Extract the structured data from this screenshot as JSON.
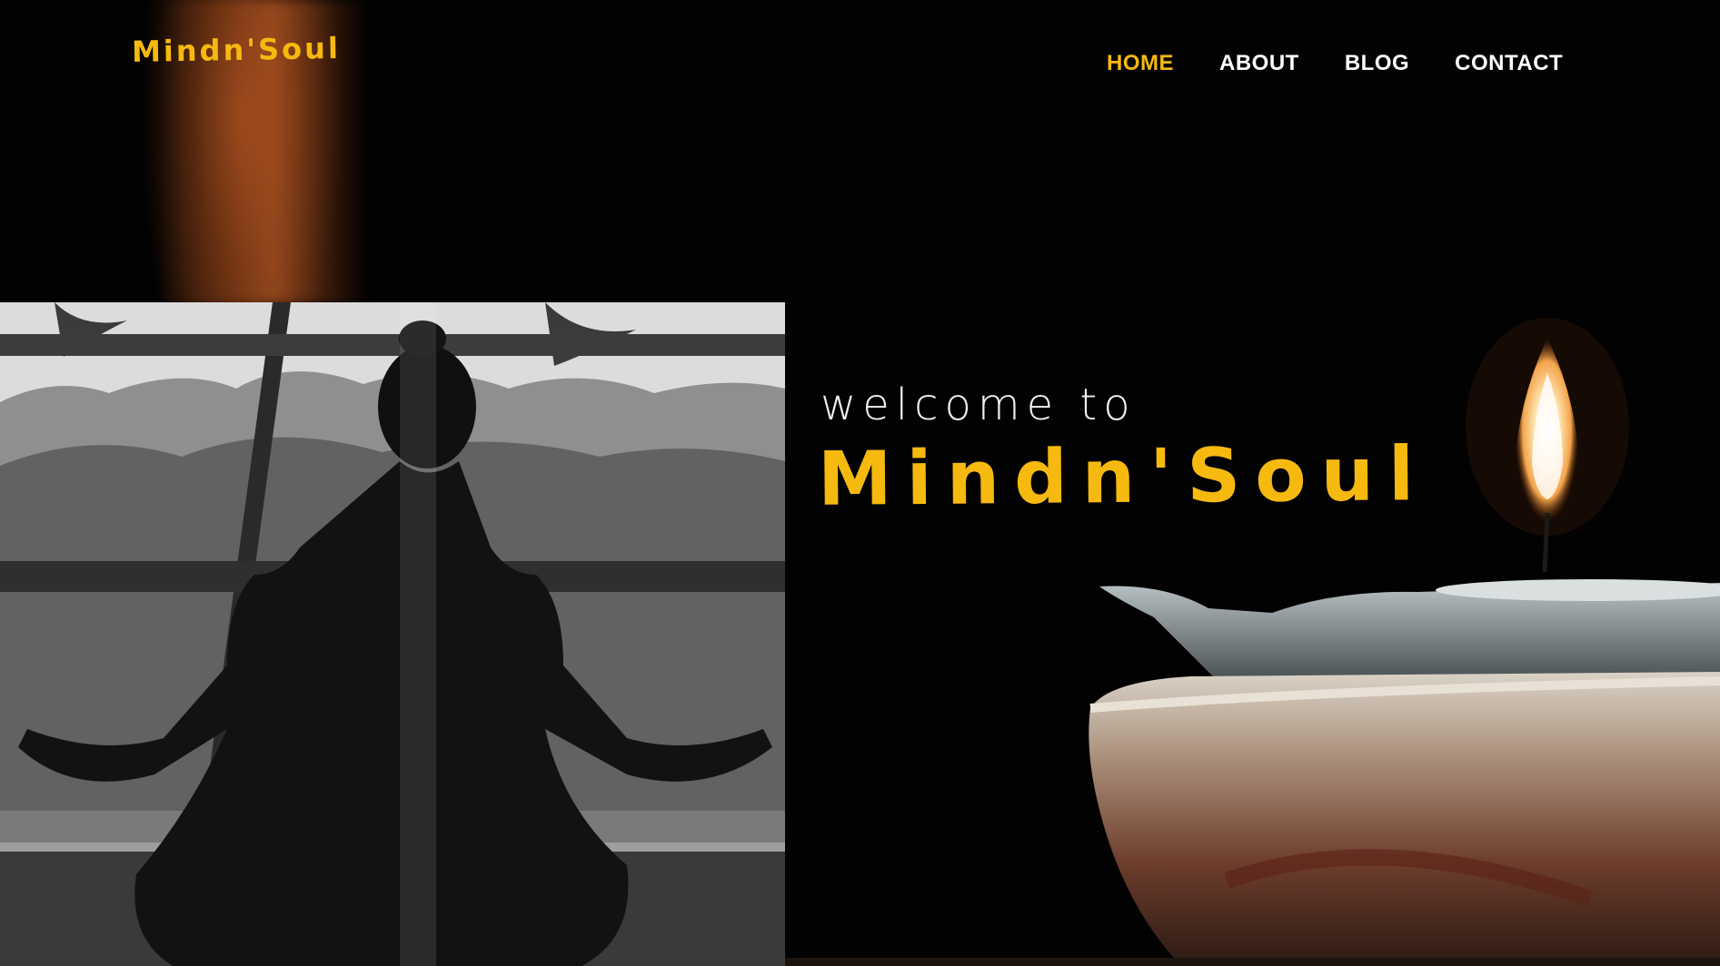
{
  "site": {
    "logo_text": "Mindn'Soul"
  },
  "nav": {
    "items": [
      {
        "label": "HOME",
        "active": true
      },
      {
        "label": "ABOUT",
        "active": false
      },
      {
        "label": "BLOG",
        "active": false
      },
      {
        "label": "CONTACT",
        "active": false
      }
    ]
  },
  "hero": {
    "welcome": "welcome to",
    "brand": "Mindn'Soul"
  },
  "colors": {
    "accent": "#f6b90f",
    "background": "#020202",
    "nav_text": "#ffffff"
  }
}
